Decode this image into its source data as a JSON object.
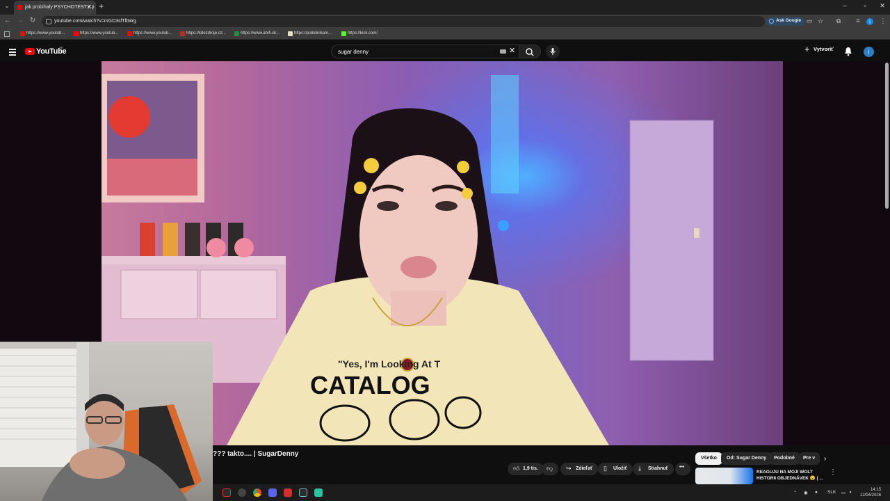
{
  "browser": {
    "tab_title": "jak probíhaly PSYCHOTESTY p",
    "url": "youtube.com/watch?v=mGD3sfTlbWg",
    "ask_google_label": "Ask Google",
    "profile_initial": "j",
    "bookmarks": [
      {
        "label": "https://www.youtub...",
        "color": "#ff0000"
      },
      {
        "label": "https://www.youtub...",
        "color": "#ff0000"
      },
      {
        "label": "https://www.youtub...",
        "color": "#ff0000"
      },
      {
        "label": "https://kdezdroje.cz...",
        "color": "#c62828"
      },
      {
        "label": "https://www.ahifi.sk...",
        "color": "#1e8e3e"
      },
      {
        "label": "https://poliklinikam...",
        "color": "#e8e0c8"
      },
      {
        "label": "https://kick.com/",
        "color": "#53fc18"
      }
    ]
  },
  "youtube": {
    "logo_text": "YouTube",
    "country_code": "SK",
    "search_value": "sugar denny",
    "create_label": "Vytvoriť",
    "avatar_initial": "j"
  },
  "video": {
    "title_visible": "??? takto.... | SugarDenny",
    "shirt_text": "CATALOG",
    "shirt_tagline": "\"Yes, I'm Looking At T"
  },
  "actions": {
    "likes": "1,9 tis.",
    "share": "Zdieľať",
    "save": "Uložiť",
    "download": "Stiahnuť"
  },
  "chips": [
    "Všetko",
    "Od: Sugar Denny",
    "Podobné",
    "Pre v"
  ],
  "recommendation": {
    "title": "REAGUJU NA MOJI WOLT HISTORII OBJEDNÁVEK 😮 | ..."
  },
  "taskbar": {
    "language": "SLK",
    "time": "14:15",
    "date": "12/04/2026"
  }
}
